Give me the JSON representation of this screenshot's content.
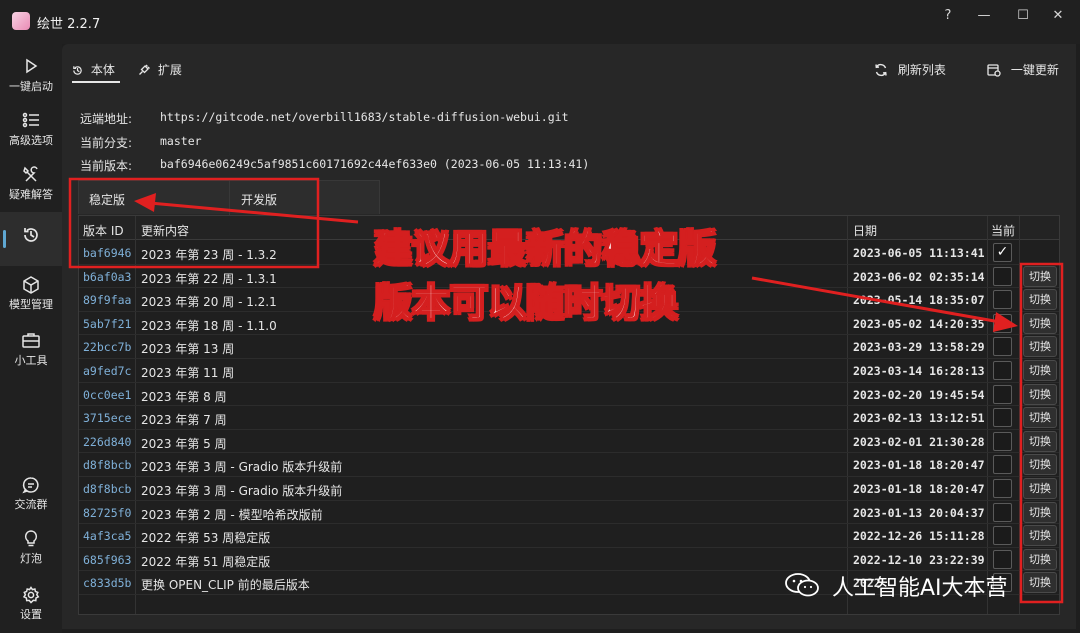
{
  "app": {
    "title": "绘世 2.2.7"
  },
  "window_controls": {
    "help": "?",
    "minimize": "—",
    "maximize": "☐",
    "close": "✕"
  },
  "sidebar": {
    "items": [
      {
        "label": "一键启动",
        "icon": "play-icon"
      },
      {
        "label": "高级选项",
        "icon": "list-icon"
      },
      {
        "label": "疑难解答",
        "icon": "tools-icon"
      },
      {
        "label": "",
        "icon": "history-icon"
      },
      {
        "label": "模型管理",
        "icon": "cube-icon"
      },
      {
        "label": "小工具",
        "icon": "toolbox-icon"
      },
      {
        "label": "交流群",
        "icon": "chat-icon"
      },
      {
        "label": "灯泡",
        "icon": "bulb-icon"
      },
      {
        "label": "设置",
        "icon": "gear-icon"
      }
    ]
  },
  "header": {
    "tabs": [
      {
        "label": "本体"
      },
      {
        "label": "扩展"
      }
    ],
    "refresh_label": "刷新列表",
    "update_label": "一键更新"
  },
  "info": {
    "remote_label": "远端地址:",
    "remote_value": "https://gitcode.net/overbill1683/stable-diffusion-webui.git",
    "branch_label": "当前分支:",
    "branch_value": "master",
    "version_label": "当前版本:",
    "version_value": "baf6946e06249c5af9851c60171692c44ef633e0 (2023-06-05 11:13:41)"
  },
  "branch_tabs": {
    "stable": "稳定版",
    "dev": "开发版"
  },
  "table": {
    "headers": {
      "id": "版本 ID",
      "message": "更新内容",
      "date": "日期",
      "current": "当前"
    },
    "switch_label": "切换",
    "rows": [
      {
        "id": "baf6946",
        "message": "2023 年第 23 周 - 1.3.2",
        "date": "2023-06-05 11:13:41",
        "current": true
      },
      {
        "id": "b6af0a3",
        "message": "2023 年第 22 周 - 1.3.1",
        "date": "2023-06-02 02:35:14",
        "current": false
      },
      {
        "id": "89f9faa",
        "message": "2023 年第 20 周 - 1.2.1",
        "date": "2023-05-14 18:35:07",
        "current": false
      },
      {
        "id": "5ab7f21",
        "message": "2023 年第 18 周 - 1.1.0",
        "date": "2023-05-02 14:20:35",
        "current": false
      },
      {
        "id": "22bcc7b",
        "message": "2023 年第 13 周",
        "date": "2023-03-29 13:58:29",
        "current": false
      },
      {
        "id": "a9fed7c",
        "message": "2023 年第 11 周",
        "date": "2023-03-14 16:28:13",
        "current": false
      },
      {
        "id": "0cc0ee1",
        "message": "2023 年第 8 周",
        "date": "2023-02-20 19:45:54",
        "current": false
      },
      {
        "id": "3715ece",
        "message": "2023 年第 7 周",
        "date": "2023-02-13 13:12:51",
        "current": false
      },
      {
        "id": "226d840",
        "message": "2023 年第 5 周",
        "date": "2023-02-01 21:30:28",
        "current": false
      },
      {
        "id": "d8f8bcb",
        "message": "2023 年第 3 周 - Gradio 版本升级前",
        "date": "2023-01-18 18:20:47",
        "current": false
      },
      {
        "id": "d8f8bcb",
        "message": "2023 年第 3 周 - Gradio 版本升级前",
        "date": "2023-01-18 18:20:47",
        "current": false
      },
      {
        "id": "82725f0",
        "message": "2023 年第 2 周 - 模型哈希改版前",
        "date": "2023-01-13 20:04:37",
        "current": false
      },
      {
        "id": "4af3ca5",
        "message": "2022 年第 53 周稳定版",
        "date": "2022-12-26 15:11:28",
        "current": false
      },
      {
        "id": "685f963",
        "message": "2022 年第 51 周稳定版",
        "date": "2022-12-10 23:22:39",
        "current": false
      },
      {
        "id": "c833d5b",
        "message": "更换 OPEN_CLIP 前的最后版本",
        "date": "2022",
        "current": false
      }
    ]
  },
  "annotation": {
    "line1": "建议用最新的稳定版",
    "line2": "版本可以随时切换",
    "color": "#e02020"
  },
  "watermark": {
    "text": "人工智能AI大本营"
  }
}
